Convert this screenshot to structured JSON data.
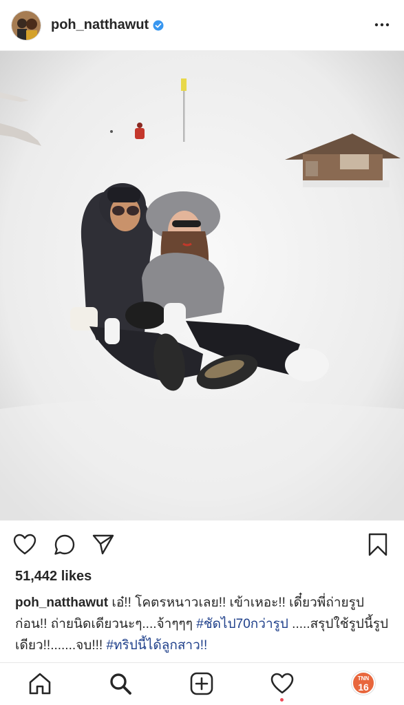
{
  "post": {
    "username": "poh_natthawut",
    "likes": "51,442 likes",
    "caption": {
      "username": "poh_natthawut",
      "text1": " เอ๋!! โคตรหนาวเลย!! เข้าเหอะ!! เดี๋ยวพี่ถ่ายรูปก่อน!! ถ่ายนิดเดียวนะๆ....จ้าๆๆๆ ",
      "hashtag1": "#ชัดไป70กว่ารูป",
      "text2": " .....สรุปใช้รูปนี้รูปเดียว!!.......จบ!!! ",
      "hashtag2": "#ทริปนี้ได้ลูกสาว!!"
    }
  },
  "profile_badge": {
    "line1": "TNN",
    "line2": "16"
  },
  "icons": {
    "header": [
      "avatar",
      "verified-badge-icon",
      "more-options-icon"
    ],
    "actions": [
      "heart-icon",
      "comment-icon",
      "share-icon",
      "bookmark-icon"
    ],
    "tabbar": [
      "home-icon",
      "search-icon",
      "add-post-icon",
      "activity-heart-icon",
      "profile-avatar"
    ]
  },
  "colors": {
    "verified": "#3897f0",
    "hashtag": "#1e3f8a",
    "notification_dot": "#ed4956",
    "profile_badge": "#e8663c"
  }
}
